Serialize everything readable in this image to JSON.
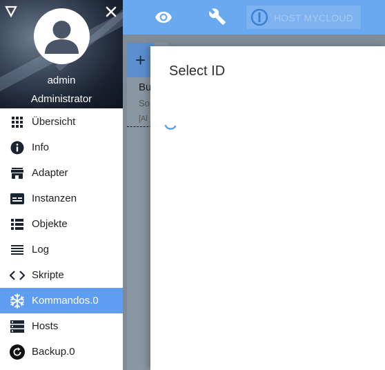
{
  "sidebar": {
    "user": {
      "name": "admin",
      "role": "Administrator"
    },
    "items": [
      {
        "label": "Übersicht",
        "icon": "grid-icon",
        "active": false
      },
      {
        "label": "Info",
        "icon": "info-icon",
        "active": false
      },
      {
        "label": "Adapter",
        "icon": "store-icon",
        "active": false
      },
      {
        "label": "Instanzen",
        "icon": "instances-icon",
        "active": false
      },
      {
        "label": "Objekte",
        "icon": "list-icon",
        "active": false
      },
      {
        "label": "Log",
        "icon": "log-icon",
        "active": false
      },
      {
        "label": "Skripte",
        "icon": "code-icon",
        "active": false
      },
      {
        "label": "Kommandos.0",
        "icon": "snowflake-icon",
        "active": true
      },
      {
        "label": "Hosts",
        "icon": "hosts-icon",
        "active": false
      },
      {
        "label": "Backup.0",
        "icon": "backup-icon",
        "active": false
      }
    ]
  },
  "toolbar": {
    "host_label": "HOST MYCLOUD"
  },
  "background_card": {
    "line1": "Bu",
    "line2": "So",
    "line3": "[Al"
  },
  "dialog": {
    "title": "Select ID"
  },
  "colors": {
    "accent": "#5e9df0",
    "toolbar": "#6aa8f0",
    "sidebar_dark": "#1a2331"
  }
}
